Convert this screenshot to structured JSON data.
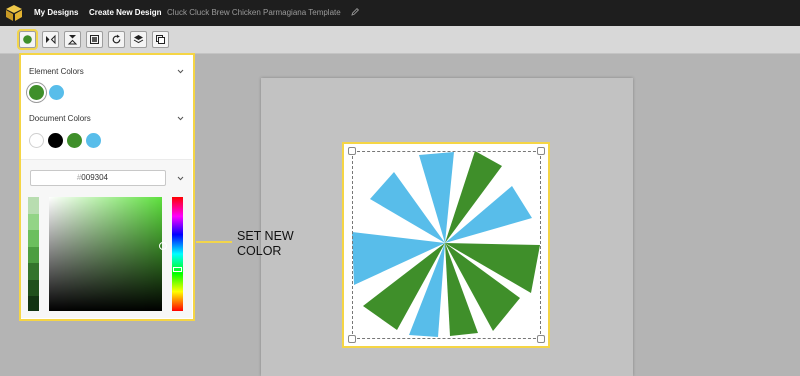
{
  "topbar": {
    "nav": {
      "my_designs": "My Designs",
      "create_new": "Create New Design"
    },
    "document_title": "Cluck Cluck Brew Chicken Parmagiana Template",
    "icons": {
      "logo": "cube-logo-icon",
      "edit": "pencil-icon"
    }
  },
  "toolbar": {
    "tools": [
      "color-fill-icon",
      "flip-horizontal-icon",
      "flip-vertical-icon",
      "opacity-icon",
      "rotate-icon",
      "layers-icon",
      "duplicate-icon"
    ],
    "active_tool": "color-fill-icon"
  },
  "color_panel": {
    "element_colors": {
      "label": "Element Colors",
      "swatches": [
        "#3f8f2a",
        "#58bdea"
      ],
      "selected": "#3f8f2a"
    },
    "document_colors": {
      "label": "Document Colors",
      "swatches": [
        "#ffffff",
        "#000000",
        "#3f8f2a",
        "#58bdea"
      ]
    },
    "hex": {
      "hash": "#",
      "value": "009304"
    },
    "shades": [
      "#b8ddb0",
      "#93d486",
      "#6cbf5e",
      "#4c9e41",
      "#33742c",
      "#20501c",
      "#123312"
    ],
    "hue_name": "green"
  },
  "canvas": {
    "graphic": "starburst",
    "colors": {
      "green": "#3f8f2a",
      "blue": "#58bdea"
    }
  },
  "annotation": {
    "text": "SET NEW COLOR",
    "line_color": "#f2d54b"
  }
}
